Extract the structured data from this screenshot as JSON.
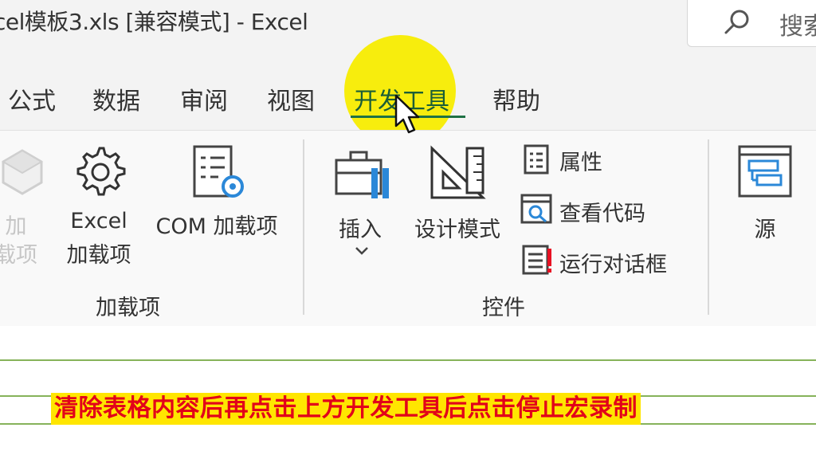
{
  "window": {
    "title": "cel模板3.xls  [兼容模式]  -  Excel",
    "search_label": "搜索"
  },
  "tabs": [
    {
      "label": "公式"
    },
    {
      "label": "数据"
    },
    {
      "label": "审阅"
    },
    {
      "label": "视图"
    },
    {
      "label": "开发工具",
      "active": true
    },
    {
      "label": "帮助"
    }
  ],
  "ribbon": {
    "addins_group": {
      "label": "加载项",
      "buttons": {
        "addins_line1": "加",
        "addins_line2": "载项",
        "excel_line1": "Excel",
        "excel_line2": "加载项",
        "com": "COM 加载项"
      }
    },
    "controls_group": {
      "label": "控件",
      "buttons": {
        "insert": "插入",
        "design_mode": "设计模式",
        "properties": "属性",
        "view_code": "查看代码",
        "run_dialog": "运行对话框"
      }
    },
    "xml_group": {
      "source": "源"
    }
  },
  "caption": "清除表格内容后再点击上方开发工具后点击停止宏录制",
  "colors": {
    "accent": "#1e7145",
    "highlight": "#f7ec00",
    "caption_bg": "#ffe600",
    "caption_text": "#e2001a"
  }
}
